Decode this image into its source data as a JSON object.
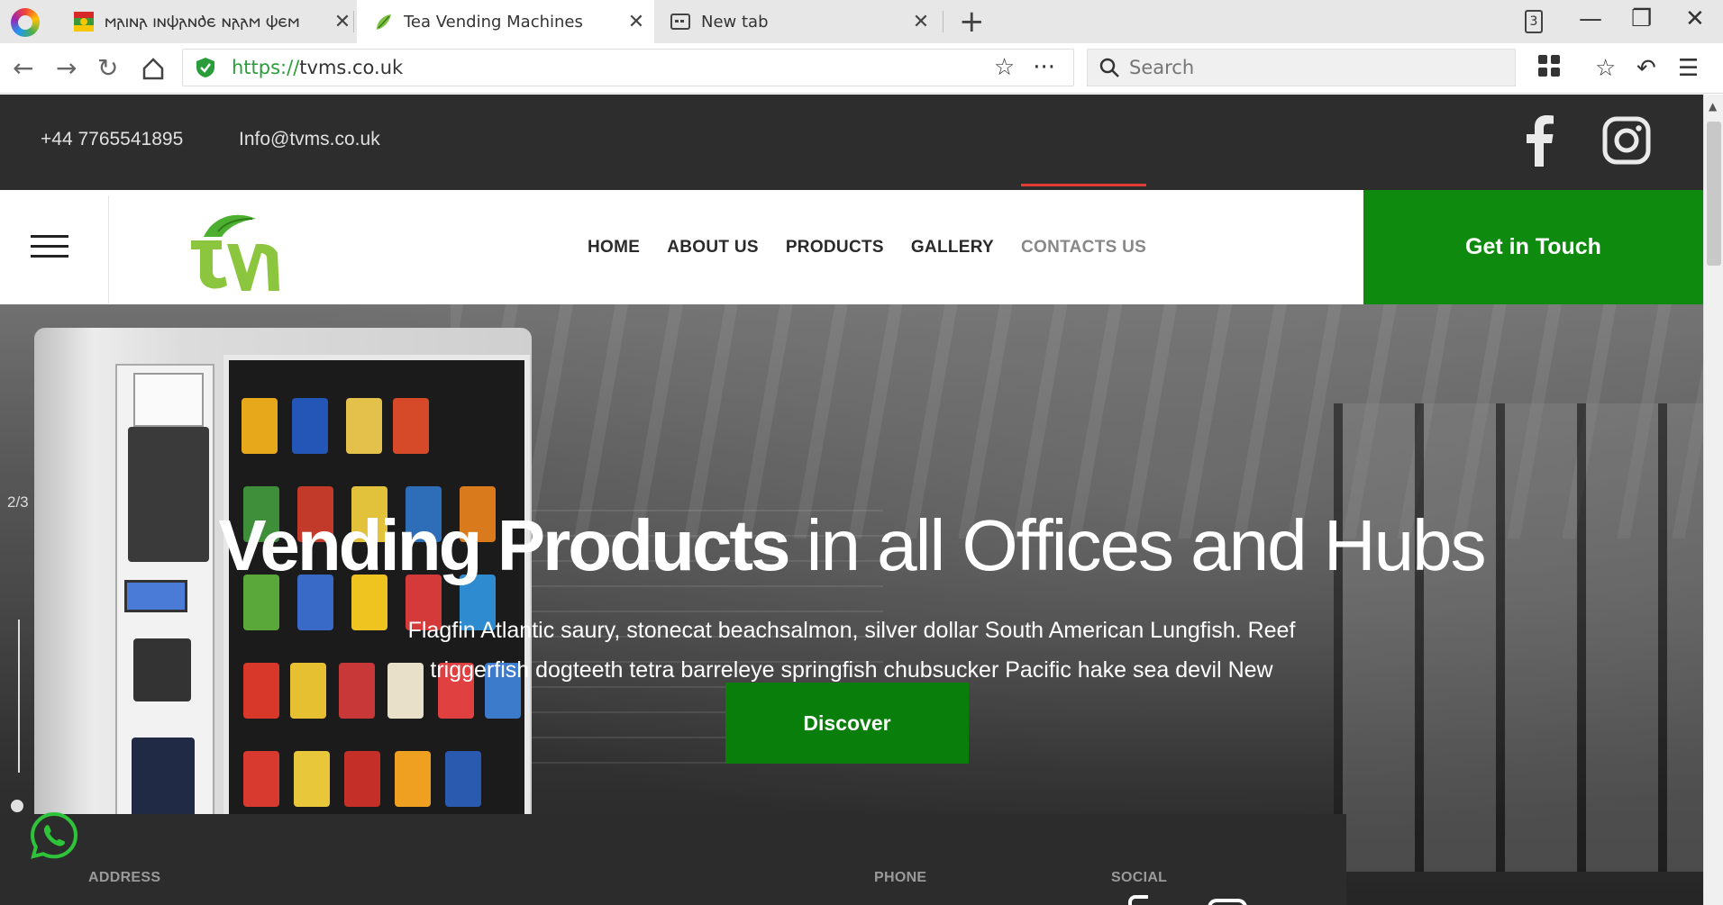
{
  "browser": {
    "tabs": [
      {
        "title": "𐌼𐌰𐌹𐌽𐌰 𐌹𐌽𐌸𐌰𐌽𐌳𐌴 𐌽𐌰𐌰𐌼 𐌸𐌴𐌼"
      },
      {
        "title": "Tea Vending Machines"
      },
      {
        "title": "New tab"
      }
    ],
    "tab_count": "3",
    "url_protocol": "https://",
    "url_host": "tvms.co.uk",
    "search_placeholder": "Search"
  },
  "site": {
    "phone": "+44 7765541895",
    "email": "Info@tvms.co.uk",
    "nav": [
      {
        "label": "HOME"
      },
      {
        "label": "ABOUT US"
      },
      {
        "label": "PRODUCTS"
      },
      {
        "label": "GALLERY"
      },
      {
        "label": "CONTACTS US"
      }
    ],
    "active_nav": "CONTACTS US",
    "cta_label": "Get in Touch",
    "brand_green": "#0e8a0e",
    "logo_green": "#7cc242"
  },
  "hero": {
    "slide_counter": "2/3",
    "headline_strong": "Vending Products",
    "headline_light": " in all Offices and Hubs",
    "subtext": "Flagfin Atlantic saury, stonecat beachsalmon, silver dollar South American Lungfish. Reef triggerfish dogteeth tetra barreleye springfish chubsucker Pacific hake sea devil New",
    "button_label": "Discover"
  },
  "info": {
    "address_label": "ADDRESS",
    "phone_label": "PHONE",
    "social_label": "SOCIAL"
  },
  "icons": {
    "facebook": "facebook-icon",
    "instagram": "instagram-icon",
    "whatsapp": "whatsapp-icon"
  }
}
